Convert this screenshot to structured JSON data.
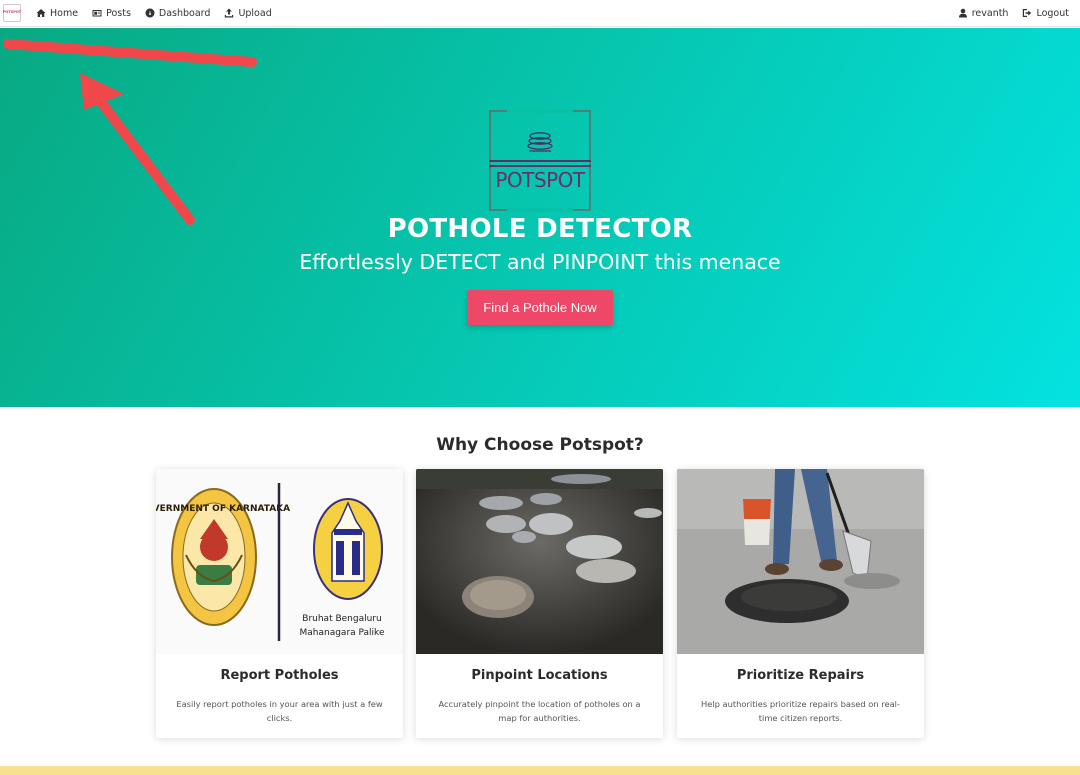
{
  "nav": {
    "logo_text": "POTSPOT",
    "items": [
      {
        "label": "Home",
        "icon": "home-icon"
      },
      {
        "label": "Posts",
        "icon": "posts-icon"
      },
      {
        "label": "Dashboard",
        "icon": "dashboard-icon"
      },
      {
        "label": "Upload",
        "icon": "upload-icon"
      }
    ],
    "user": {
      "label": "revanth",
      "icon": "user-icon"
    },
    "logout": {
      "label": "Logout",
      "icon": "logout-icon"
    }
  },
  "hero": {
    "logo_text": "POTSPOT",
    "title": "POTHOLE DETECTOR",
    "subtitle": "Effortlessly DETECT and PINPOINT this menace",
    "cta_label": "Find a Pothole Now",
    "gradient_start": "#08a982",
    "gradient_end": "#04e2e0",
    "cta_color": "#ef4767",
    "annotation_color": "#f0484a"
  },
  "features": {
    "title": "Why Choose Potspot?",
    "cards": [
      {
        "title": "Report Potholes",
        "description": "Easily report potholes in your area with just a few clicks.",
        "image": "karnataka-government-and-bbmp-emblems",
        "emblem_left_text": "GOVERNMENT OF KARNATAKA",
        "emblem_right_text": [
          "Bruhat Bengaluru",
          "Mahanagara Palike"
        ]
      },
      {
        "title": "Pinpoint Locations",
        "description": "Accurately pinpoint the location of potholes on a map for authorities.",
        "image": "water-filled-potholes-road"
      },
      {
        "title": "Prioritize Repairs",
        "description": "Help authorities prioritize repairs based on real-time citizen reports.",
        "image": "worker-filling-pothole-with-asphalt"
      }
    ]
  },
  "footer_band_color": "#f8e08e"
}
